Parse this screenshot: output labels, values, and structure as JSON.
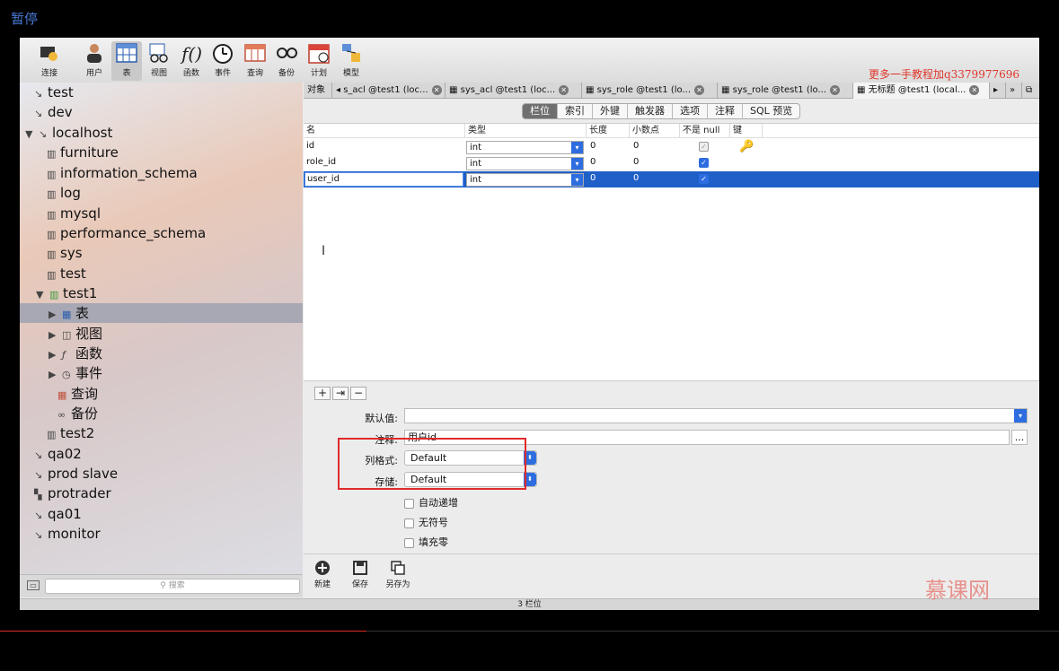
{
  "pause_label": "暂停",
  "promo": "更多一手教程加q3379977696",
  "toolbar": {
    "items": [
      {
        "label": "连接",
        "icon": "connection-icon"
      },
      {
        "label": "用户",
        "icon": "user-icon"
      },
      {
        "label": "表",
        "icon": "table-icon"
      },
      {
        "label": "视图",
        "icon": "view-icon"
      },
      {
        "label": "函数",
        "icon": "function-icon"
      },
      {
        "label": "事件",
        "icon": "event-icon"
      },
      {
        "label": "查询",
        "icon": "query-icon"
      },
      {
        "label": "备份",
        "icon": "backup-icon"
      },
      {
        "label": "计划",
        "icon": "schedule-icon"
      },
      {
        "label": "模型",
        "icon": "model-icon"
      }
    ]
  },
  "sidebar": {
    "items": [
      {
        "label": "test",
        "level": 0
      },
      {
        "label": "dev",
        "level": 0
      },
      {
        "label": "localhost",
        "level": 0
      },
      {
        "label": "furniture",
        "level": 1
      },
      {
        "label": "information_schema",
        "level": 1
      },
      {
        "label": "log",
        "level": 1
      },
      {
        "label": "mysql",
        "level": 1
      },
      {
        "label": "performance_schema",
        "level": 1
      },
      {
        "label": "sys",
        "level": 1
      },
      {
        "label": "test",
        "level": 1
      },
      {
        "label": "test1",
        "level": 1
      },
      {
        "label": "表",
        "level": 2
      },
      {
        "label": "视图",
        "level": 2
      },
      {
        "label": "函数",
        "level": 2
      },
      {
        "label": "事件",
        "level": 2
      },
      {
        "label": "查询",
        "level": 2
      },
      {
        "label": "备份",
        "level": 2
      },
      {
        "label": "test2",
        "level": 1
      },
      {
        "label": "qa02",
        "level": 0
      },
      {
        "label": "prod slave",
        "level": 0
      },
      {
        "label": "protrader",
        "level": 0
      },
      {
        "label": "qa01",
        "level": 0
      },
      {
        "label": "monitor",
        "level": 0
      }
    ],
    "search_placeholder": "搜索"
  },
  "tabs": [
    {
      "label": "对象"
    },
    {
      "label": "s_acl @test1 (loc..."
    },
    {
      "label": "sys_acl @test1 (loc..."
    },
    {
      "label": "sys_role @test1 (lo..."
    },
    {
      "label": "sys_role @test1 (lo..."
    },
    {
      "label": "无标题 @test1 (local..."
    }
  ],
  "subtabs": [
    "栏位",
    "索引",
    "外键",
    "触发器",
    "选项",
    "注释",
    "SQL 预览"
  ],
  "grid": {
    "headers": [
      "名",
      "类型",
      "长度",
      "小数点",
      "不是 null",
      "键"
    ],
    "rows": [
      {
        "name": "id",
        "type": "int",
        "length": "0",
        "decimals": "0",
        "not_null": true,
        "key": true
      },
      {
        "name": "role_id",
        "type": "int",
        "length": "0",
        "decimals": "0",
        "not_null": true,
        "key": false
      },
      {
        "name": "user_id",
        "type": "int",
        "length": "0",
        "decimals": "0",
        "not_null": true,
        "key": false
      }
    ]
  },
  "props": {
    "default_label": "默认值:",
    "default_value": "",
    "comment_label": "注释:",
    "comment_value": "用户id",
    "column_format_label": "列格式:",
    "column_format_value": "Default",
    "storage_label": "存储:",
    "storage_value": "Default",
    "opt_auto_increment": "自动递增",
    "opt_unsigned": "无符号",
    "opt_zerofill": "填充零",
    "ellipsis": "..."
  },
  "actions": {
    "new": "新建",
    "save": "保存",
    "save_as": "另存为"
  },
  "status": "3 栏位",
  "watermark": "慕课网",
  "colors": {
    "accent": "#2d6de0",
    "highlight": "#e02a2a",
    "selection": "#1f5fc8"
  }
}
